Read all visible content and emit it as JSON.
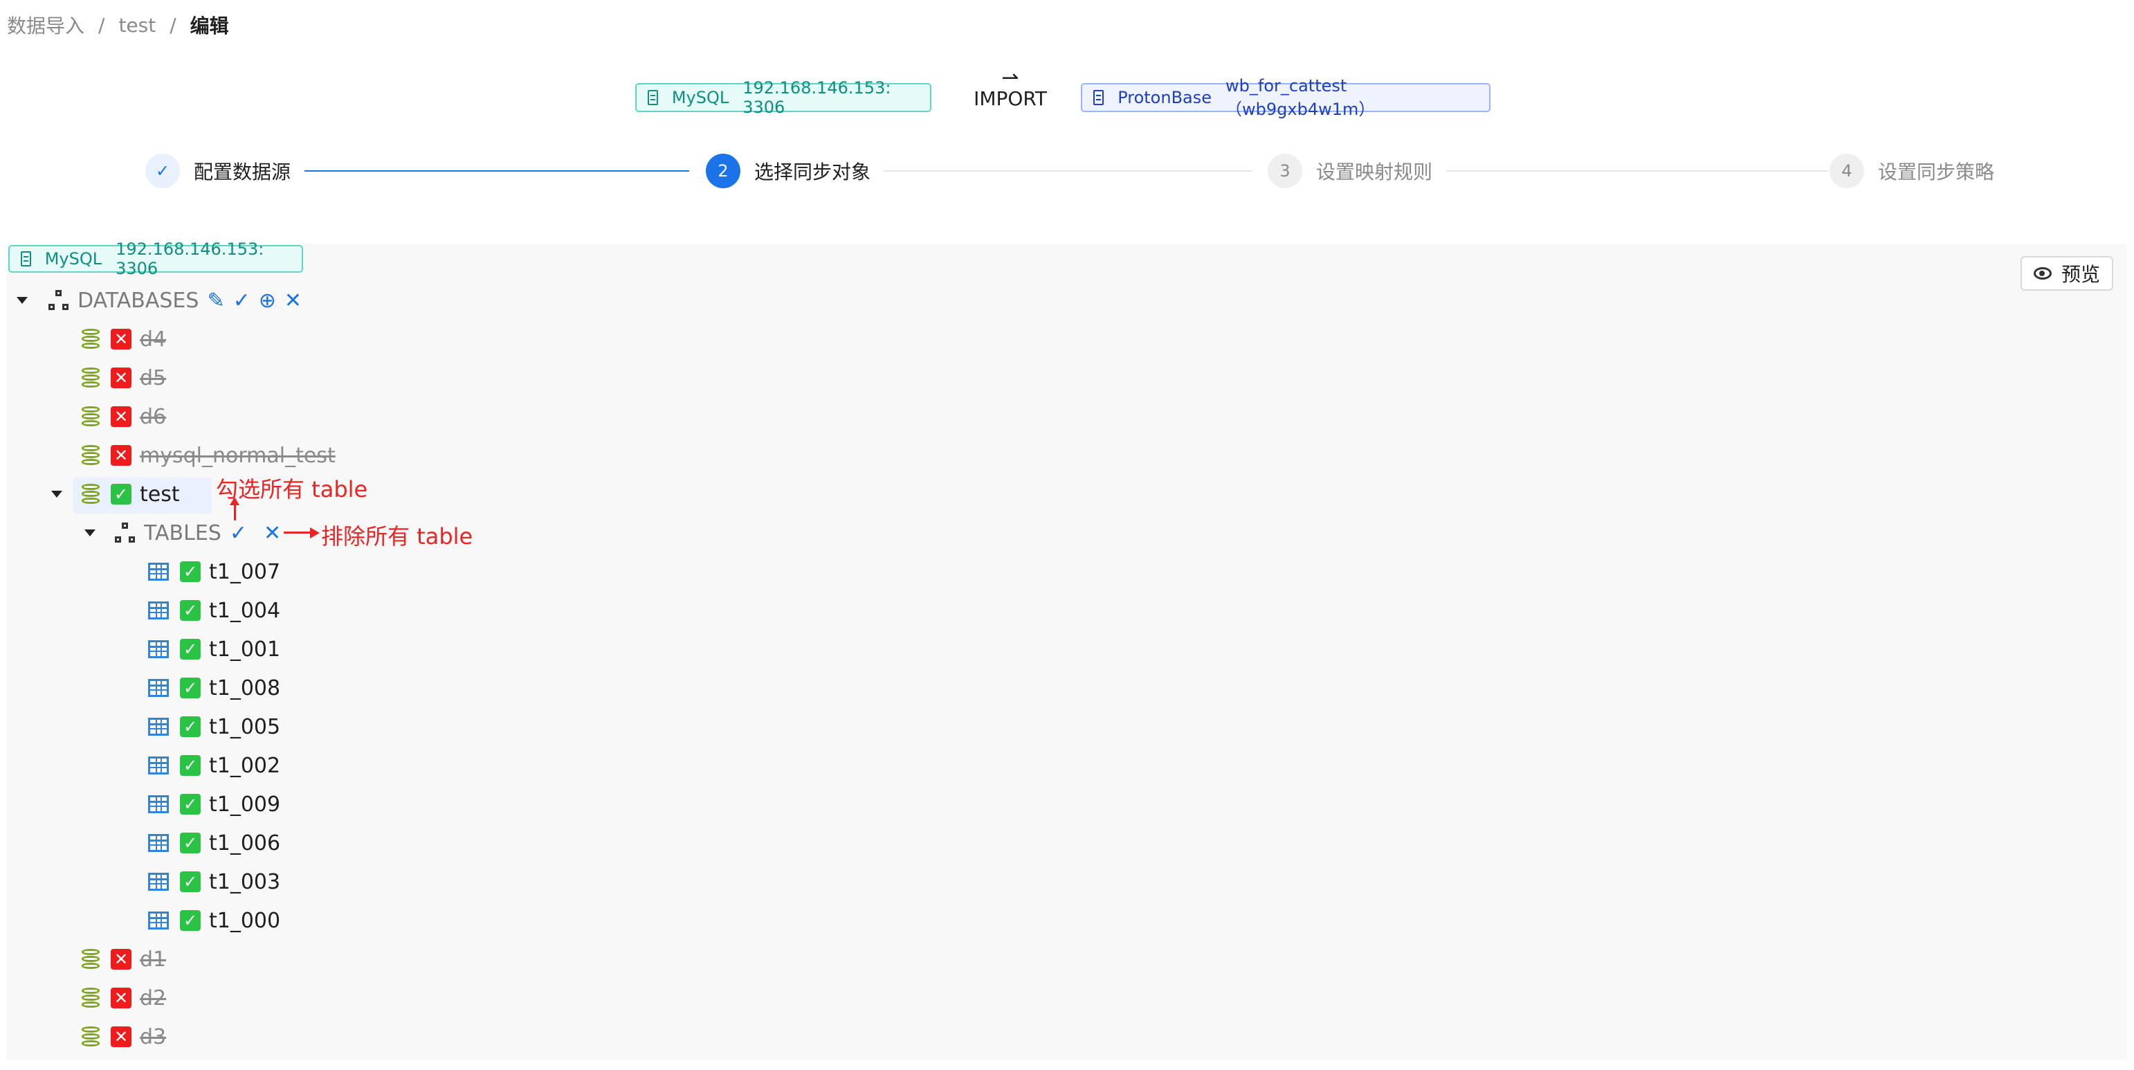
{
  "breadcrumb": {
    "item1": "数据导入",
    "item2": "test",
    "current": "编辑",
    "sep": "/"
  },
  "connection": {
    "source": {
      "kind": "MySQL",
      "addr": "192.168.146.153: 3306"
    },
    "arrow_label": "IMPORT",
    "target": {
      "kind": "ProtonBase",
      "addr": "wb_for_cattest（wb9gxb4w1m）"
    }
  },
  "steps": [
    {
      "num": "✓",
      "label": "配置数据源",
      "state": "done"
    },
    {
      "num": "2",
      "label": "选择同步对象",
      "state": "active"
    },
    {
      "num": "3",
      "label": "设置映射规则",
      "state": "wait"
    },
    {
      "num": "4",
      "label": "设置同步策略",
      "state": "wait"
    }
  ],
  "panel": {
    "source_tag": {
      "kind": "MySQL",
      "addr": "192.168.146.153: 3306"
    },
    "preview_label": "预览",
    "databases_label": "DATABASES",
    "tables_label": "TABLES"
  },
  "databases_top": [
    {
      "name": "d4",
      "selected": false
    },
    {
      "name": "d5",
      "selected": false
    },
    {
      "name": "d6",
      "selected": false
    },
    {
      "name": "mysql_normal_test",
      "selected": false
    }
  ],
  "test_db": {
    "name": "test",
    "selected": true
  },
  "tables": [
    {
      "name": "t1_007"
    },
    {
      "name": "t1_004"
    },
    {
      "name": "t1_001"
    },
    {
      "name": "t1_008"
    },
    {
      "name": "t1_005"
    },
    {
      "name": "t1_002"
    },
    {
      "name": "t1_009"
    },
    {
      "name": "t1_006"
    },
    {
      "name": "t1_003"
    },
    {
      "name": "t1_000"
    }
  ],
  "databases_bottom": [
    {
      "name": "d1",
      "selected": false
    },
    {
      "name": "d2",
      "selected": false
    },
    {
      "name": "d3",
      "selected": false
    }
  ],
  "annotations": {
    "select_all": "勾选所有 table",
    "exclude_all": "排除所有 table"
  },
  "colors": {
    "accent": "#1a73e8",
    "checked": "#2bc346",
    "excluded": "#ee1c1c",
    "annotation": "#ea2323"
  }
}
